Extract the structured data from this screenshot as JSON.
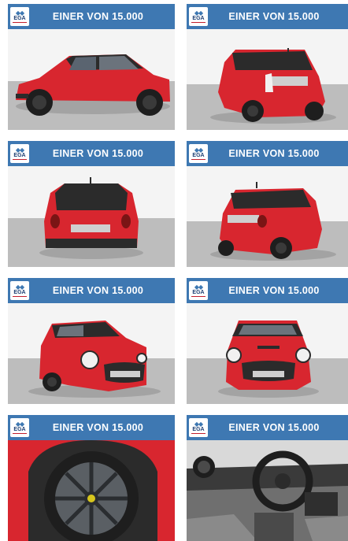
{
  "logo": {
    "text": "EGA",
    "icon": "ega-logo-icon"
  },
  "banner_text": "EINER VON 15.000",
  "photos": [
    {
      "view": "side",
      "icon": "car-side-photo"
    },
    {
      "view": "rear-left",
      "icon": "car-rear-left-photo"
    },
    {
      "view": "rear",
      "icon": "car-rear-photo"
    },
    {
      "view": "rear-right",
      "icon": "car-rear-right-photo"
    },
    {
      "view": "front-left",
      "icon": "car-front-left-photo"
    },
    {
      "view": "front",
      "icon": "car-front-photo"
    },
    {
      "view": "wheel",
      "icon": "car-wheel-photo"
    },
    {
      "view": "interior",
      "icon": "car-interior-photo"
    }
  ],
  "colors": {
    "banner": "#3e78b2",
    "car_red": "#d8262f",
    "roof": "#2b2b2b"
  }
}
